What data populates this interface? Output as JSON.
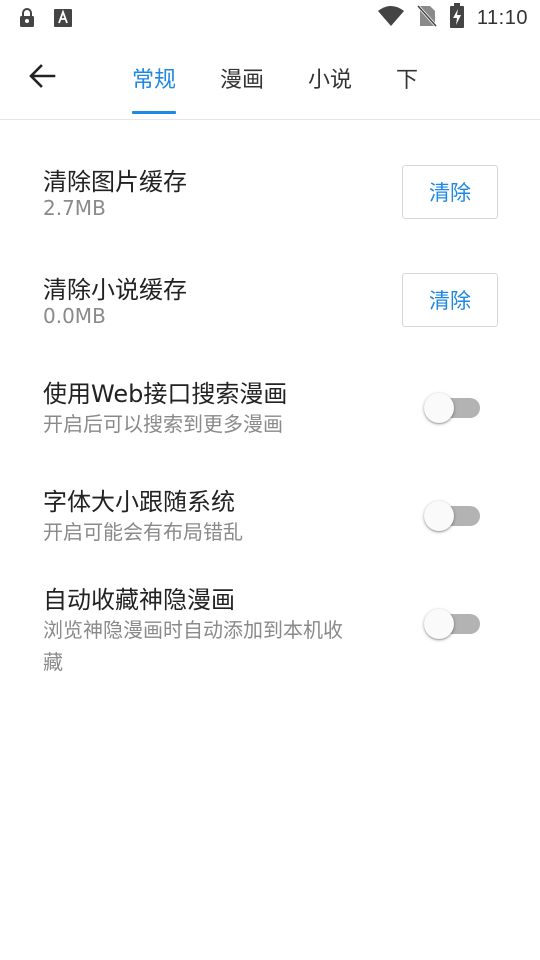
{
  "status_bar": {
    "time": "11:10",
    "icons": [
      "lock-icon",
      "font-a-icon",
      "wifi-icon",
      "no-sim-icon",
      "battery-charging-icon"
    ]
  },
  "app_bar": {
    "back_icon": "arrow-left-icon",
    "tabs": [
      {
        "label": "常规",
        "active": true
      },
      {
        "label": "漫画",
        "active": false
      },
      {
        "label": "小说",
        "active": false
      },
      {
        "label": "下",
        "active": false
      }
    ]
  },
  "settings": {
    "image_cache": {
      "title": "清除图片缓存",
      "size": "2.7MB",
      "button": "清除"
    },
    "novel_cache": {
      "title": "清除小说缓存",
      "size": "0.0MB",
      "button": "清除"
    },
    "web_search": {
      "title": "使用Web接口搜索漫画",
      "subtitle": "开启后可以搜索到更多漫画",
      "enabled": false
    },
    "font_follow": {
      "title": "字体大小跟随系统",
      "subtitle": "开启可能会有布局错乱",
      "enabled": false
    },
    "auto_collect": {
      "title": "自动收藏神隐漫画",
      "subtitle_line1": "浏览神隐漫画时自动添加到本机收",
      "subtitle_line2": "藏",
      "enabled": false
    }
  },
  "colors": {
    "accent": "#1e88e5",
    "switch_track_off": "#b3b3b3",
    "secondary_text": "#8a8a8a"
  }
}
